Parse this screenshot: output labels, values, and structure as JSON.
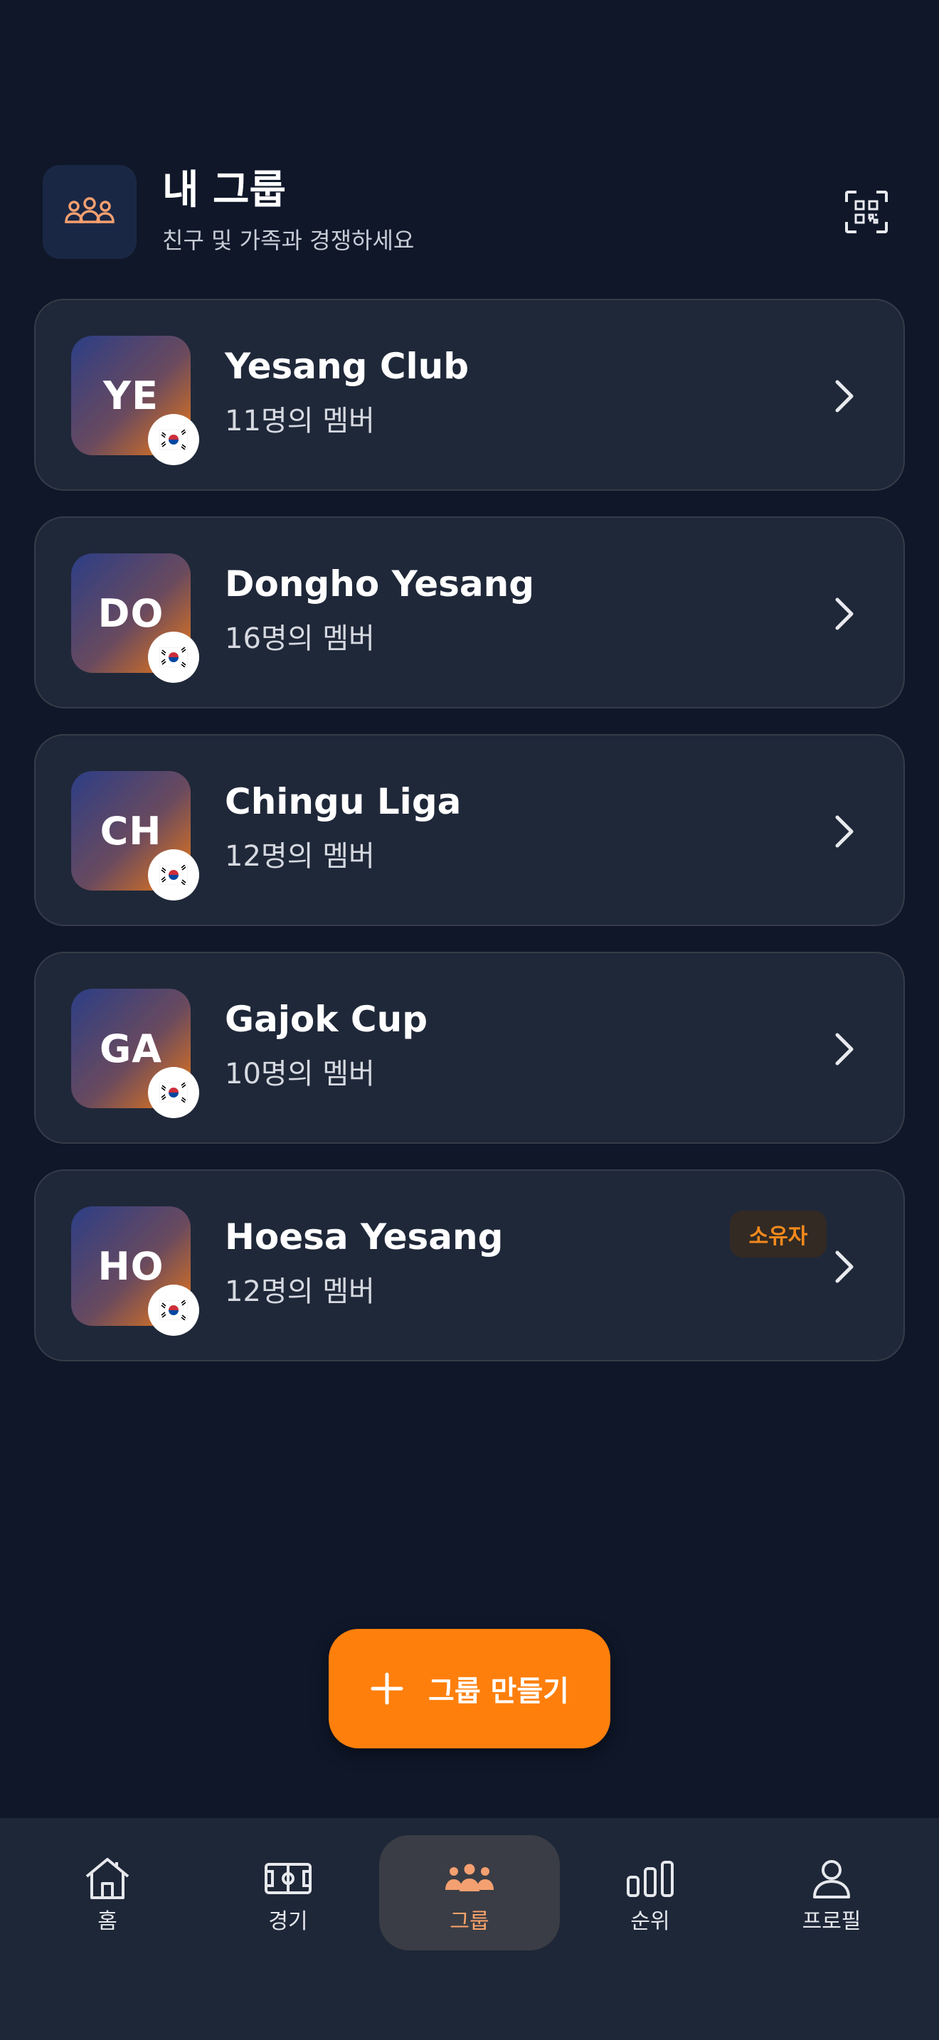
{
  "header": {
    "title": "내 그룹",
    "subtitle": "친구 및 가족과 경쟁하세요",
    "icon": "users-icon",
    "action_icon": "qr-scan-icon"
  },
  "groups": [
    {
      "initials": "YE",
      "name": "Yesang Club",
      "members": "11명의 멤버",
      "flag": "🇰🇷",
      "owner_badge": ""
    },
    {
      "initials": "DO",
      "name": "Dongho Yesang",
      "members": "16명의 멤버",
      "flag": "🇰🇷",
      "owner_badge": ""
    },
    {
      "initials": "CH",
      "name": "Chingu Liga",
      "members": "12명의 멤버",
      "flag": "🇰🇷",
      "owner_badge": ""
    },
    {
      "initials": "GA",
      "name": "Gajok Cup",
      "members": "10명의 멤버",
      "flag": "🇰🇷",
      "owner_badge": ""
    },
    {
      "initials": "HO",
      "name": "Hoesa Yesang",
      "members": "12명의 멤버",
      "flag": "🇰🇷",
      "owner_badge": "소유자"
    }
  ],
  "create_button": {
    "label": "그룹 만들기",
    "icon": "plus-icon"
  },
  "nav": [
    {
      "label": "홈",
      "icon": "home-icon",
      "active": false
    },
    {
      "label": "경기",
      "icon": "pitch-icon",
      "active": false
    },
    {
      "label": "그룹",
      "icon": "users-icon",
      "active": true
    },
    {
      "label": "순위",
      "icon": "bar-chart-icon",
      "active": false
    },
    {
      "label": "프로필",
      "icon": "user-icon",
      "active": false
    }
  ],
  "colors": {
    "background": "#0f1729",
    "card": "#1f2839",
    "accent": "#fe7f0c",
    "active_nav_label": "#fda46a"
  }
}
